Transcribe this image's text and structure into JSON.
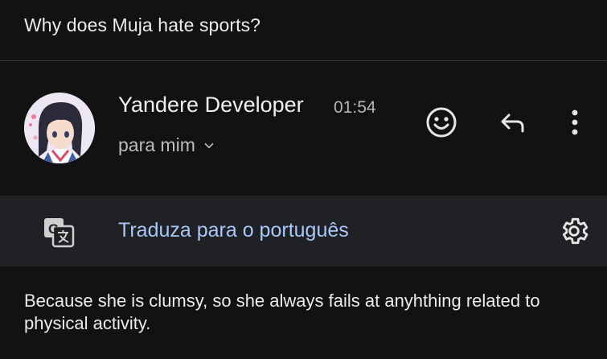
{
  "message": {
    "subject": "Why does Muja hate sports?",
    "sender_name": "Yandere Developer",
    "time": "01:54",
    "recipient": "para mim",
    "body": "Because she is clumsy, so she always fails at anyhthing related to physical activity."
  },
  "actions": {
    "emoji_icon": "smiley-icon",
    "reply_icon": "reply-icon",
    "more_icon": "more-vertical-icon"
  },
  "translation": {
    "icon": "google-translate-icon",
    "link_text": "Traduza para o português",
    "settings_icon": "gear-icon"
  },
  "colors": {
    "background": "#121212",
    "translate_bar": "#202124",
    "link": "#a8c7fa"
  }
}
